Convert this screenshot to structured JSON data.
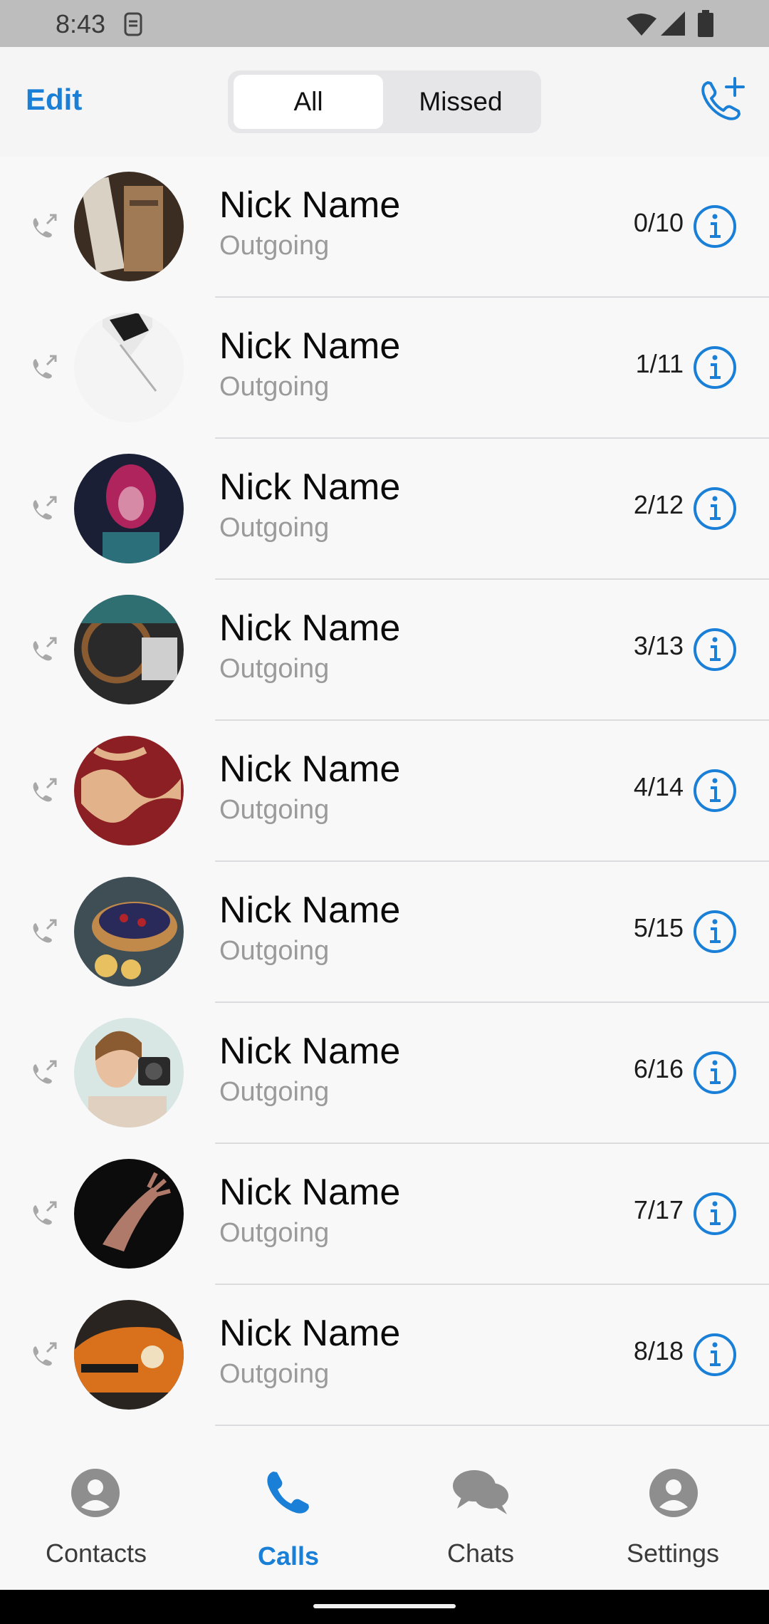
{
  "status_bar": {
    "time": "8:43"
  },
  "header": {
    "edit_label": "Edit",
    "tabs": [
      {
        "label": "All",
        "selected": true
      },
      {
        "label": "Missed",
        "selected": false
      }
    ],
    "new_call_icon": "phone-plus-icon"
  },
  "calls": [
    {
      "name": "Nick Name",
      "type": "Outgoing",
      "date": "0/10",
      "avatar": "avatar-products"
    },
    {
      "name": "Nick Name",
      "type": "Outgoing",
      "date": "1/11",
      "avatar": "avatar-laptop"
    },
    {
      "name": "Nick Name",
      "type": "Outgoing",
      "date": "2/12",
      "avatar": "avatar-neon-woman"
    },
    {
      "name": "Nick Name",
      "type": "Outgoing",
      "date": "3/13",
      "avatar": "avatar-car-interior"
    },
    {
      "name": "Nick Name",
      "type": "Outgoing",
      "date": "4/14",
      "avatar": "avatar-marble"
    },
    {
      "name": "Nick Name",
      "type": "Outgoing",
      "date": "5/15",
      "avatar": "avatar-tart"
    },
    {
      "name": "Nick Name",
      "type": "Outgoing",
      "date": "6/16",
      "avatar": "avatar-camera-woman"
    },
    {
      "name": "Nick Name",
      "type": "Outgoing",
      "date": "7/17",
      "avatar": "avatar-hand"
    },
    {
      "name": "Nick Name",
      "type": "Outgoing",
      "date": "8/18",
      "avatar": "avatar-orange-car"
    }
  ],
  "tab_bar": [
    {
      "label": "Contacts",
      "icon": "person-icon",
      "active": false
    },
    {
      "label": "Calls",
      "icon": "phone-icon",
      "active": true
    },
    {
      "label": "Chats",
      "icon": "chat-bubbles-icon",
      "active": false
    },
    {
      "label": "Settings",
      "icon": "person-icon",
      "active": false
    }
  ],
  "colors": {
    "accent": "#1a7fd6",
    "secondary_text": "#9a9a9a",
    "divider": "#dcdcde"
  }
}
